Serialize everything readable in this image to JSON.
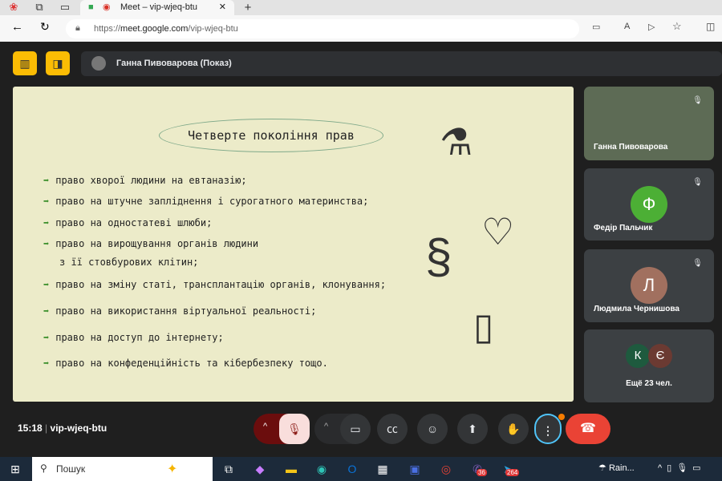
{
  "browser": {
    "tab_title": "Meet – vip-wjeq-btu",
    "url_prefix": "https://",
    "url_host": "meet.google.com",
    "url_path": "/vip-wjeq-btu"
  },
  "presenter": {
    "label": "Ганна Пивоварова (Показ)"
  },
  "slide": {
    "title": "Четверте покоління прав",
    "bullets": [
      "право хворої людини на евтаназію;",
      "право на штучне запліднення і сурогатного материнства;",
      "право на одностатеві шлюби;",
      "право на вирощування органів людини",
      "з її стовбурових клітин;",
      "право на зміну статі, трансплантацію органів, клонування;",
      "право на використання віртуальної реальності;",
      "право на доступ до інтернету;",
      "право на конфеденційність та кібербезпеку тощо."
    ]
  },
  "participants": [
    {
      "name": "Ганна Пивоварова"
    },
    {
      "name": "Федір Пальчик",
      "initial": "Ф",
      "color": "#4caf35"
    },
    {
      "name": "Людмила Чернишова",
      "initial": "Л",
      "color": "#a1705f"
    }
  ],
  "more": {
    "label": "Ещё 23 чел.",
    "initials": [
      "К",
      "Є"
    ]
  },
  "meeting": {
    "time": "15:18",
    "code": "vip-wjeq-btu"
  },
  "taskbar": {
    "search": "Пошук",
    "weather": "Rain...",
    "viber_badge": "36",
    "telegram_badge": "264"
  }
}
